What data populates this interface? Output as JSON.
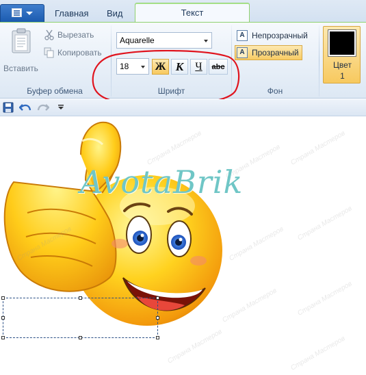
{
  "tabs": {
    "home": "Главная",
    "view": "Вид",
    "text": "Текст"
  },
  "clipboard": {
    "paste": "Вставить",
    "cut": "Вырезать",
    "copy": "Копировать",
    "group": "Буфер обмена"
  },
  "font": {
    "name": "Aquarelle",
    "size": "18",
    "bold": "Ж",
    "italic": "К",
    "underline": "Ч",
    "strike": "abc",
    "group": "Шрифт"
  },
  "background": {
    "opaque": "Непрозрачный",
    "transparent": "Прозрачный",
    "group": "Фон",
    "selected": "transparent"
  },
  "color": {
    "label": "Цвет",
    "number": "1",
    "value": "#000000"
  },
  "canvas": {
    "brand_text": "AvotaBrik",
    "watermark": "Страна Мастеров",
    "highlight_color": "#e0141e"
  }
}
